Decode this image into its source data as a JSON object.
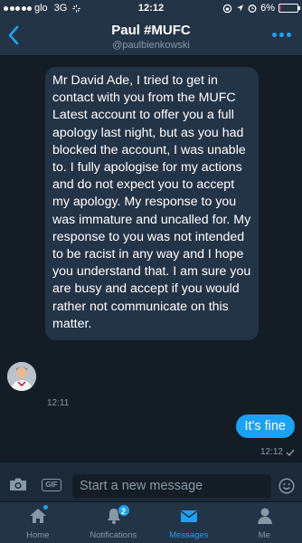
{
  "status_bar": {
    "carrier": "glo",
    "network": "3G",
    "time": "12:12",
    "battery": "6%",
    "battery_level": 0.06
  },
  "header": {
    "name": "Paul #MUFC",
    "handle": "@paulbienkowski"
  },
  "messages": [
    {
      "direction": "incoming",
      "text": "Mr David Ade, I tried to get in contact with you from the MUFC Latest account to offer you a full apology last night, but as you had blocked the account, I was unable to. I fully apologise for my actions and do not expect you to accept my apology. My response to you was immature and uncalled for. My response to you was not intended to be racist in any way and I hope you understand that. I am sure you are busy and accept if you would rather not communicate on this matter.",
      "time": "12:11"
    },
    {
      "direction": "outgoing",
      "text": "It's fine",
      "time": "12:12"
    }
  ],
  "compose": {
    "placeholder": "Start a new message",
    "gif_label": "GIF"
  },
  "tabs": [
    {
      "label": "Home",
      "icon": "home-icon",
      "active": false
    },
    {
      "label": "Notifications",
      "icon": "bell-icon",
      "active": false,
      "badge": "2"
    },
    {
      "label": "Messages",
      "icon": "envelope-icon",
      "active": true
    },
    {
      "label": "Me",
      "icon": "person-icon",
      "active": false
    }
  ],
  "colors": {
    "background": "#141d26",
    "bar": "#243447",
    "accent": "#1da1f2",
    "muted": "#8899a6"
  }
}
